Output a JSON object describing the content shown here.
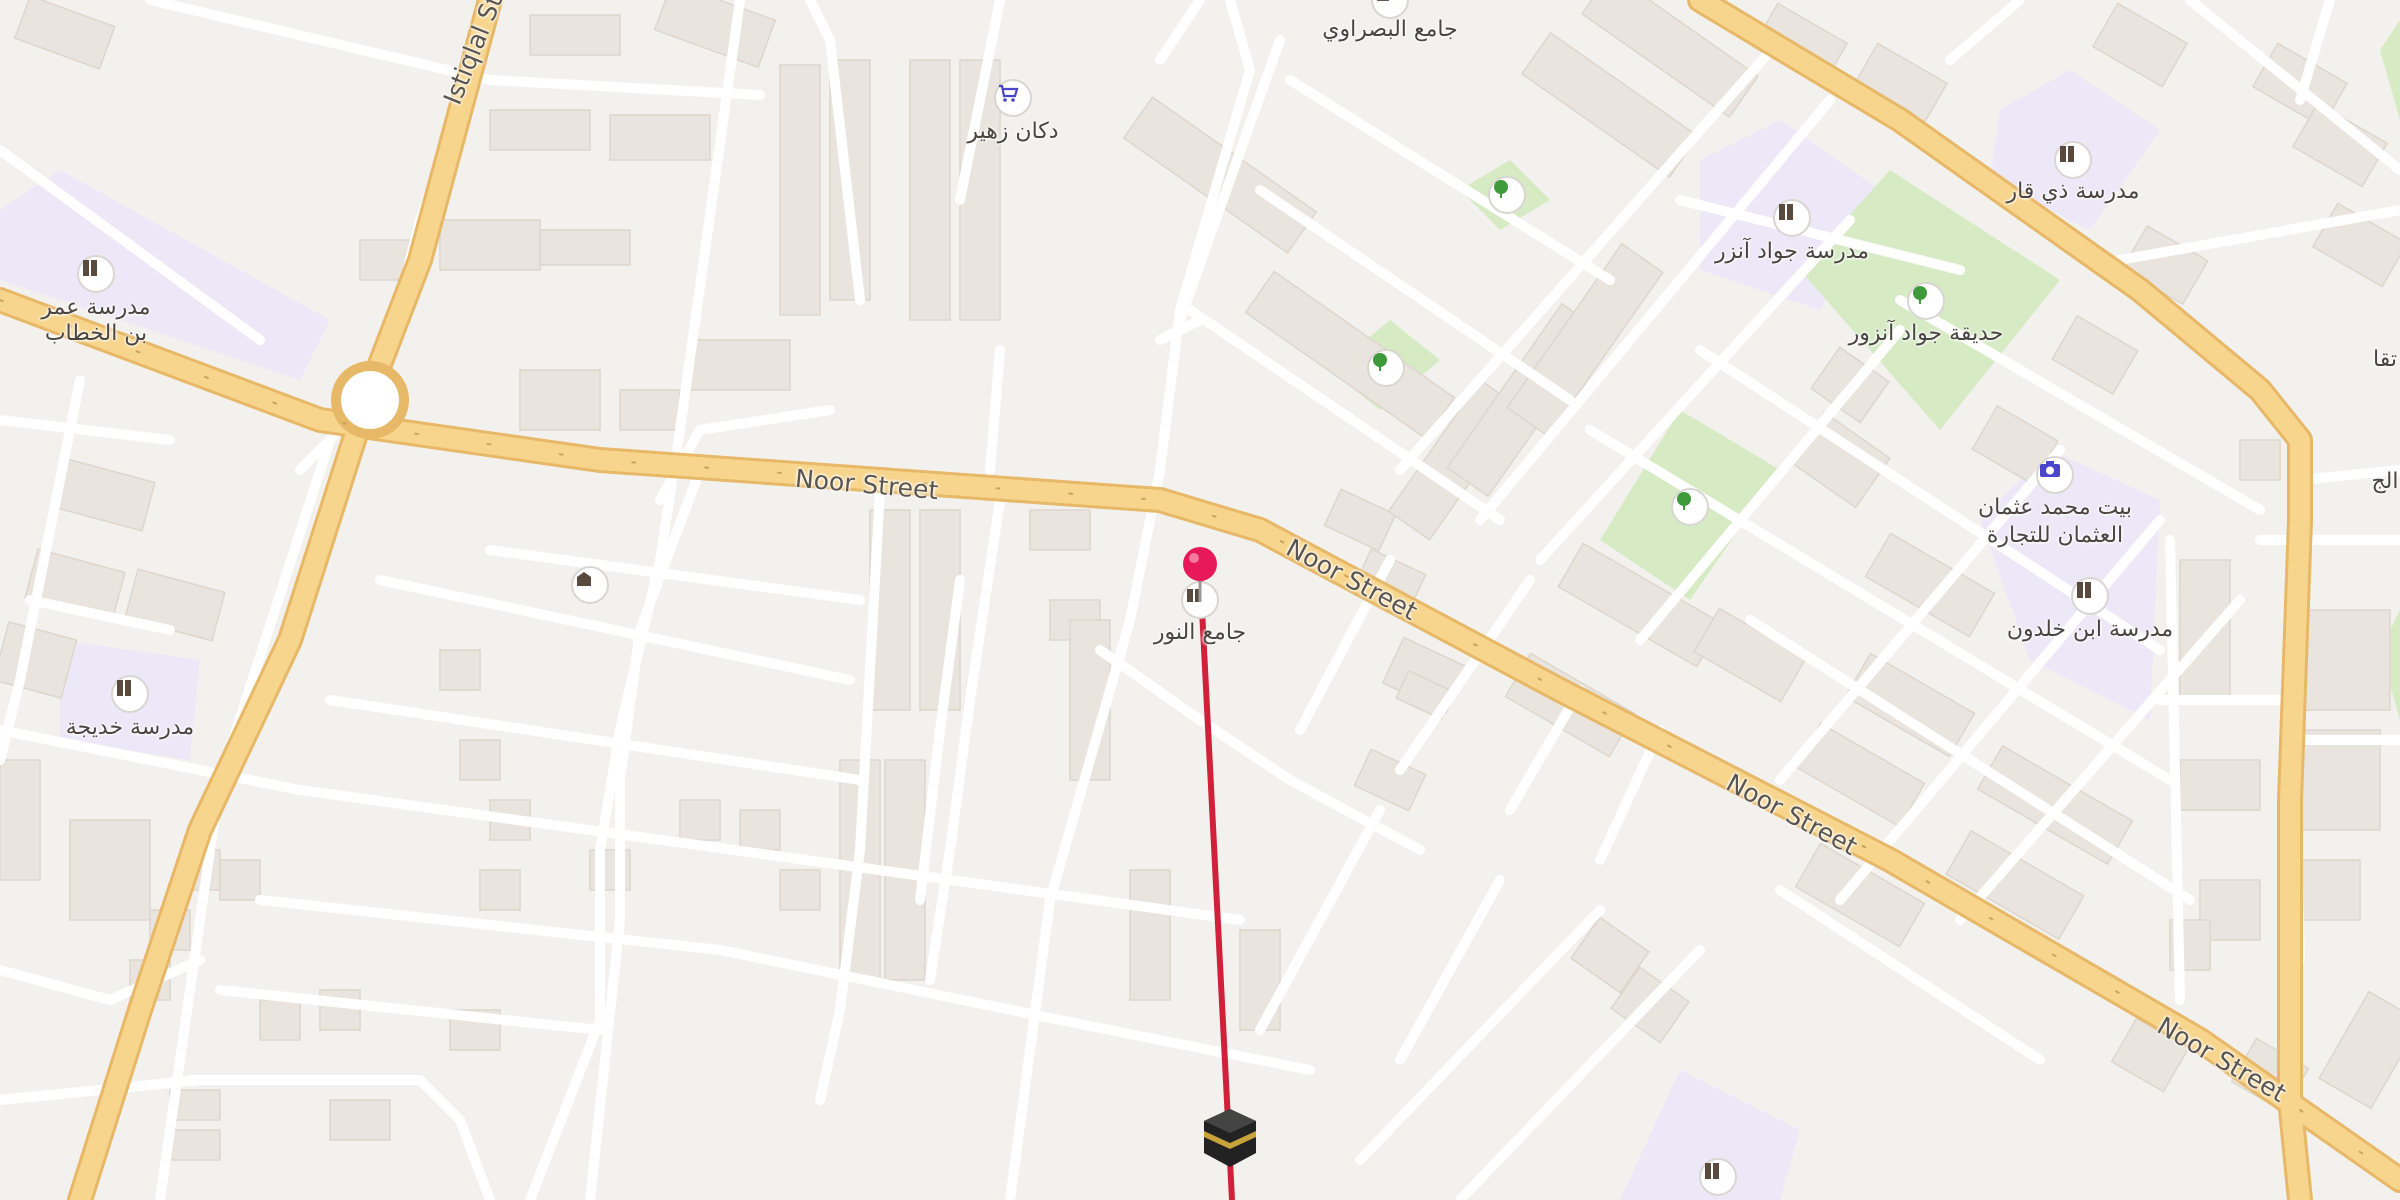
{
  "map": {
    "streets": {
      "noor_1": "Noor Street",
      "noor_2": "Noor Street",
      "noor_3": "Noor Street",
      "noor_4": "Noor Street",
      "istiqlal": "Istiqlal St"
    },
    "places": {
      "basrawi_mosque": "جامع البصراوي",
      "zuhair_shop": "دكان زهير",
      "omar_school_1": "مدرسة عمر",
      "omar_school_2": "بن الخطاب",
      "khadija_school": "مدرسة خديجة",
      "jawad_school": "مدرسة جواد آنزر",
      "jawad_park": "حديقة جواد آنزور",
      "thiqar_school": "مدرسة ذي قار",
      "uthman_house_1": "بيت محمد عثمان",
      "uthman_house_2": "العثمان للتجارة",
      "khaldun_school": "مدرسة ابن خلدون",
      "noor_mosque": "جامع النور",
      "edge_label_1": "تقا",
      "edge_label_2": "الج"
    },
    "colors": {
      "background": "#f3f1ee",
      "major_road": "#f7d58c",
      "major_road_casing": "#e7b868",
      "minor_road": "#ffffff",
      "building": "#e9e4dd",
      "park": "#d6ebc4",
      "school_area": "#ece8f7",
      "qibla_line": "#d0203a",
      "pin": "#e8195a"
    },
    "icons": {
      "school": "school-icon",
      "park": "tree-icon",
      "mosque": "mosque-icon",
      "shop": "cart-icon",
      "camera": "camera-icon",
      "building": "building-icon",
      "pin": "location-pin-icon",
      "qibla": "kaaba-icon"
    }
  }
}
